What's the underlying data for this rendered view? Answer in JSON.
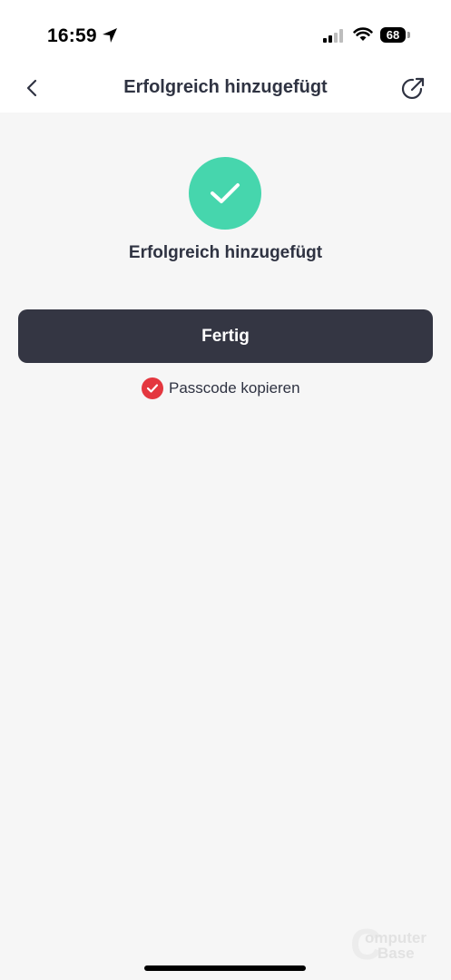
{
  "status_bar": {
    "time": "16:59",
    "battery": "68",
    "icons": [
      "location-arrow-icon",
      "cellular-signal-icon",
      "wifi-icon",
      "battery-icon"
    ]
  },
  "nav": {
    "title": "Erfolgreich hinzugefügt",
    "back_icon": "chevron-left-icon",
    "share_icon": "share-external-icon"
  },
  "main": {
    "success_icon": "checkmark-circle-icon",
    "success_text": "Erfolgreich hinzugefügt",
    "done_label": "Fertig",
    "copy_label": "Passcode kopieren",
    "copy_checked": true
  },
  "watermark": {
    "line1": "omputer",
    "line2": "Base"
  },
  "colors": {
    "success_green": "#46d6ad",
    "button_dark": "#343643",
    "checkbox_red": "#e4373f",
    "background": "#f6f6f6"
  }
}
